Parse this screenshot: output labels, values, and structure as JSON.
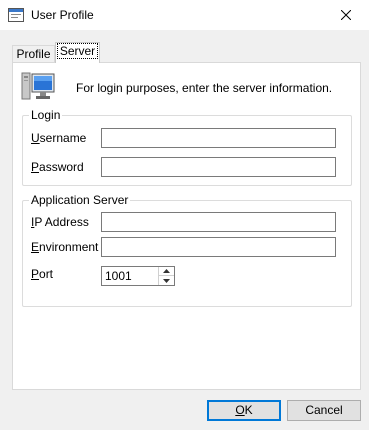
{
  "window": {
    "title": "User Profile",
    "icon": "app-window-icon",
    "close_icon": "close-icon"
  },
  "tabs": [
    {
      "label": "Profile",
      "selected": false
    },
    {
      "label": "Server",
      "selected": true
    }
  ],
  "info": {
    "icon": "monitor-icon",
    "text": "For login purposes, enter the server information."
  },
  "login": {
    "legend": "Login",
    "username": {
      "label_mnemonic": "U",
      "label_rest": "sername",
      "value": ""
    },
    "password": {
      "label_mnemonic": "P",
      "label_rest": "assword",
      "value": ""
    }
  },
  "app_server": {
    "legend": "Application Server",
    "ip": {
      "label_mnemonic": "I",
      "label_rest": "P Address",
      "value": ""
    },
    "environment": {
      "label_mnemonic": "E",
      "label_rest": "nvironment",
      "value": ""
    },
    "port": {
      "label_mnemonic": "P",
      "label_rest": "ort",
      "value": "1001"
    }
  },
  "buttons": {
    "ok": {
      "mnemonic": "O",
      "rest": "K"
    },
    "cancel": {
      "label": "Cancel"
    }
  },
  "colors": {
    "accent": "#0078d7",
    "background": "#f0f0f0"
  }
}
